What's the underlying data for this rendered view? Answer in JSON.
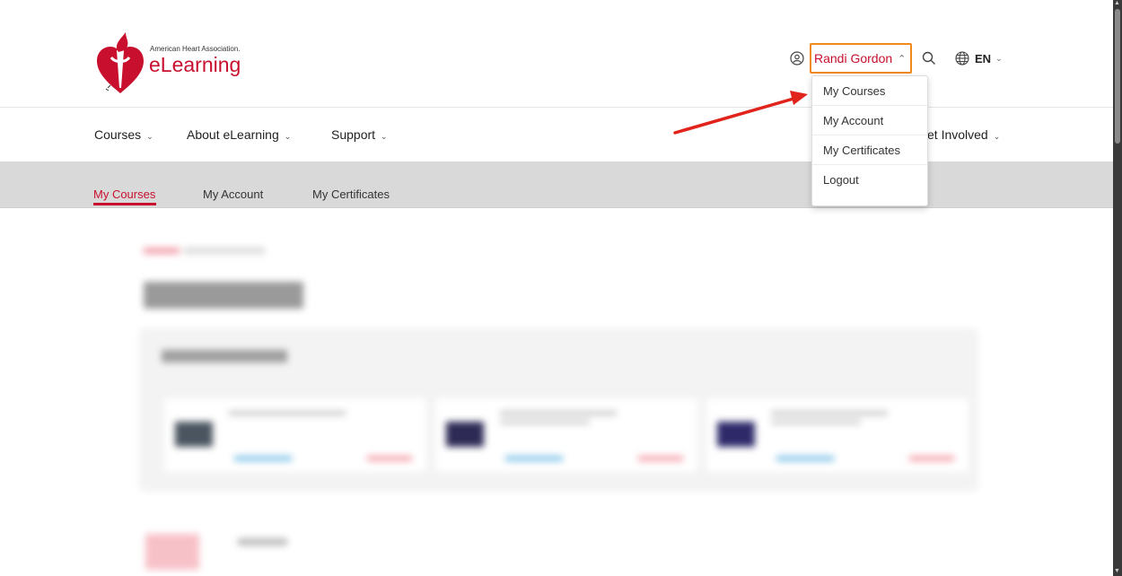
{
  "header": {
    "logo_org": "American Heart Association.",
    "logo_product": "eLearning",
    "user_name": "Randi Gordon",
    "language": "EN"
  },
  "nav": {
    "items": [
      "Courses",
      "About eLearning",
      "Support"
    ],
    "partial_item": "et Involved"
  },
  "subnav": {
    "tabs": [
      "My Courses",
      "My Account",
      "My Certificates"
    ],
    "active_tab": "My Courses"
  },
  "user_menu": {
    "items": [
      "My Courses",
      "My Account",
      "My Certificates",
      "Logout"
    ]
  },
  "colors": {
    "brand_red": "#c8102e",
    "focus_outline": "#f08a1c",
    "subnav_bg": "#d9d9d9",
    "annotation_arrow": "#e0231b"
  },
  "icons": {
    "user": "user-circle-icon",
    "search": "search-icon",
    "language": "globe-icon"
  }
}
